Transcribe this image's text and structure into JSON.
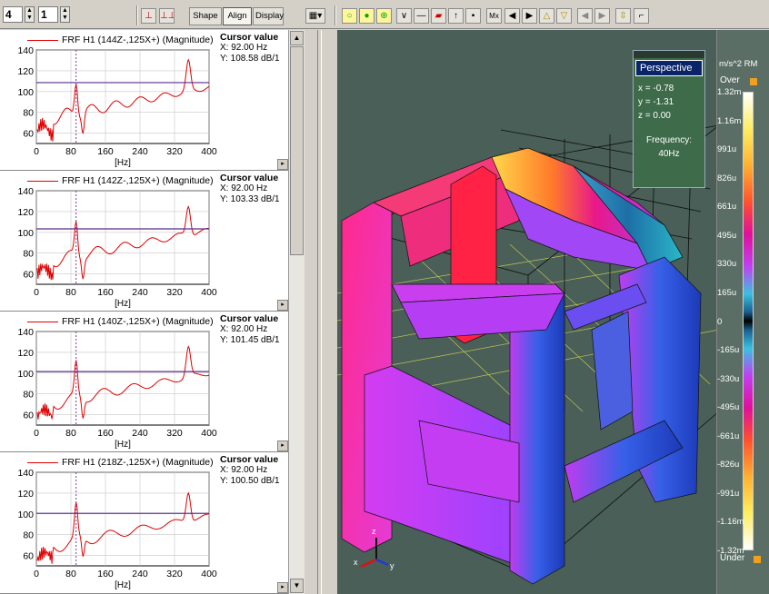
{
  "toolbar": {
    "spin1": "4",
    "spin2": "1",
    "tabs": [
      "Shape",
      "Align",
      "Display"
    ],
    "active_tab": "Align"
  },
  "panels": [
    {
      "legend": "FRF H1 (144Z-,125X+) (Magnitude)",
      "cursor_title": "Cursor value",
      "cursor_x": "X: 92.00 Hz",
      "cursor_y": "Y: 108.58 dB/1",
      "hline_y": 108.58
    },
    {
      "legend": "FRF H1 (142Z-,125X+) (Magnitude)",
      "cursor_title": "Cursor value",
      "cursor_x": "X: 92.00 Hz",
      "cursor_y": "Y: 103.33 dB/1",
      "hline_y": 103.33
    },
    {
      "legend": "FRF H1 (140Z-,125X+) (Magnitude)",
      "cursor_title": "Cursor value",
      "cursor_x": "X: 92.00 Hz",
      "cursor_y": "Y: 101.45 dB/1",
      "hline_y": 101.45
    },
    {
      "legend": "FRF H1 (218Z-,125X+) (Magnitude)",
      "cursor_title": "Cursor value",
      "cursor_x": "X: 92.00 Hz",
      "cursor_y": "Y: 100.50 dB/1",
      "hline_y": 100.5
    }
  ],
  "chart_data": {
    "type": "line",
    "xlabel": "[Hz]",
    "x_ticks": [
      "0",
      "80",
      "160",
      "240",
      "320",
      "400"
    ],
    "y_ticks": [
      "60",
      "80",
      "100",
      "120",
      "140"
    ],
    "xlim": [
      0,
      400
    ],
    "ylim": [
      50,
      140
    ],
    "cursor_x": 92,
    "color": "#e00000"
  },
  "perspective": {
    "title": "Perspective",
    "x": "x =  -0.78",
    "y": "y =  -1.31",
    "z": "z =   0.00",
    "freq_label": "Frequency:",
    "freq_value": "40Hz"
  },
  "colorbar": {
    "unit": "m/s^2 RM",
    "over": "Over",
    "under": "Under",
    "ticks": [
      "1.32m",
      "1.16m",
      "991u",
      "826u",
      "661u",
      "495u",
      "330u",
      "165u",
      "0",
      "-165u",
      "-330u",
      "-495u",
      "-661u",
      "-826u",
      "-991u",
      "-1.16m",
      "-1.32m"
    ]
  },
  "axes_labels": {
    "z": "z",
    "y": "y",
    "x": "x"
  }
}
